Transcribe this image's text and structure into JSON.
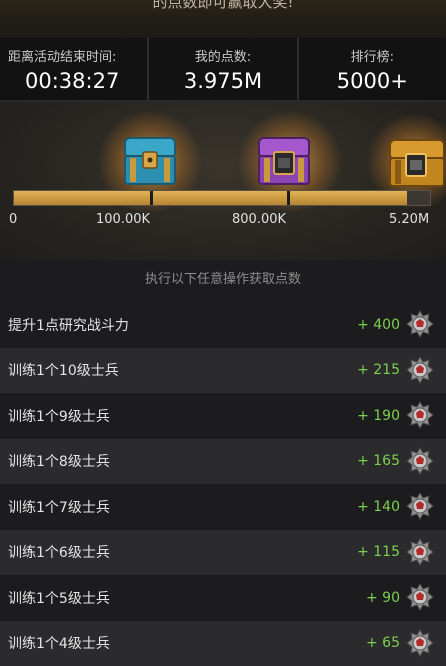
{
  "top_banner_text": "的点数即可赢取大奖!",
  "stats": {
    "time_label": "距离活动结束时间:",
    "time_value": "00:38:27",
    "points_label": "我的点数:",
    "points_value": "3.975M",
    "rank_label": "排行榜:",
    "rank_value": "5000+"
  },
  "rewards": {
    "chests": [
      {
        "name": "blue-chest",
        "color": "#3aa6c8"
      },
      {
        "name": "purple-chest",
        "color": "#9b4fc2"
      },
      {
        "name": "gold-chest",
        "color": "#d69a2e"
      }
    ],
    "progress_fraction": 0.945,
    "ticks": [
      "0",
      "100.00K",
      "800.00K",
      "5.20M"
    ]
  },
  "tasks_header": "执行以下任意操作获取点数",
  "tasks": [
    {
      "name": "提升1点研究战斗力",
      "points": "+ 400"
    },
    {
      "name": "训练1个10级士兵",
      "points": "+ 215"
    },
    {
      "name": "训练1个9级士兵",
      "points": "+ 190"
    },
    {
      "name": "训练1个8级士兵",
      "points": "+ 165"
    },
    {
      "name": "训练1个7级士兵",
      "points": "+ 140"
    },
    {
      "name": "训练1个6级士兵",
      "points": "+ 115"
    },
    {
      "name": "训练1个5级士兵",
      "points": "+ 90"
    },
    {
      "name": "训练1个4级士兵",
      "points": "+ 65"
    }
  ],
  "colors": {
    "accent_gold": "#d8a849",
    "points_green": "#7bd04f"
  }
}
